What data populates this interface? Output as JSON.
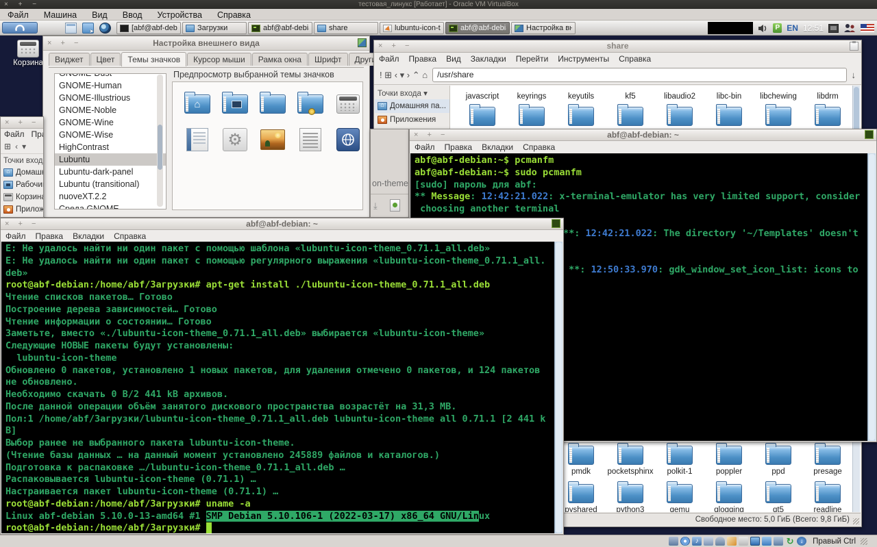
{
  "host": {
    "controls": "× + −",
    "title": "тестовая_линукс [Работает] - Oracle VM VirtualBox",
    "menu": [
      "Файл",
      "Машина",
      "Вид",
      "Ввод",
      "Устройства",
      "Справка"
    ],
    "status_hint": "Правый Ctrl",
    "status_icons": [
      "hdd-icon",
      "optical-icon",
      "audio-icon",
      "network-icon",
      "usb-icon",
      "pen-icon",
      "card-icon",
      "display-icon",
      "sharedfolder-icon",
      "video-icon",
      "refresh-icon",
      "download-icon"
    ]
  },
  "panel": {
    "launchers": [
      "show-desktop-icon",
      "file-manager-icon",
      "web-browser-icon"
    ],
    "taskbar": [
      {
        "label": "[abf@abf-debian...",
        "icon": "monitor",
        "active": false
      },
      {
        "label": "Загрузки",
        "icon": "folder",
        "active": false
      },
      {
        "label": "abf@abf-debian:...",
        "icon": "terminal",
        "active": false
      },
      {
        "label": "share",
        "icon": "folder",
        "active": false
      },
      {
        "label": "lubuntu-icon-the...",
        "icon": "archive",
        "active": false
      },
      {
        "label": "abf@abf-debian:...",
        "icon": "terminal",
        "active": true
      },
      {
        "label": "Настройка вне...",
        "icon": "settings",
        "active": false
      }
    ],
    "tray": {
      "lang": "EN",
      "clock": "12:51"
    }
  },
  "desktop": {
    "trash_label": "Корзина"
  },
  "appearance": {
    "controls": "× + −",
    "title": "Настройка внешнего вида",
    "tabs": [
      "Виджет",
      "Цвет",
      "Темы значков",
      "Курсор мыши",
      "Рамка окна",
      "Шрифт",
      "Другие"
    ],
    "active_tab_index": 2,
    "themes": [
      "GNOME-Dust",
      "GNOME-Human",
      "GNOME-Illustrious",
      "GNOME-Noble",
      "GNOME-Wine",
      "GNOME-Wise",
      "HighContrast",
      "Lubuntu",
      "Lubuntu-dark-panel",
      "Lubuntu (transitional)",
      "nuoveXT.2.2",
      "Среда GNOME"
    ],
    "selected_theme": "Lubuntu",
    "preview_label": "Предпросмотр выбранной темы значков",
    "preview_icons_row1": [
      "folder-home-icon",
      "folder-desktop-icon",
      "folder-icon",
      "folder-network-icon",
      "calculator-icon"
    ],
    "preview_icons_row2": [
      "book-icon",
      "gear-icon",
      "image-icon",
      "document-icon",
      "globe-icon"
    ]
  },
  "left_fm": {
    "controls": "× + −",
    "menu": [
      "Файл",
      "Правка"
    ],
    "toolbar": [
      "⊞",
      "‹",
      "▾"
    ],
    "places_label": "Точки входа",
    "places": [
      {
        "label": "Домашняя",
        "icon": "home"
      },
      {
        "label": "Рабочий",
        "icon": "desktop"
      },
      {
        "label": "Корзина",
        "icon": "trash"
      },
      {
        "label": "Приложения",
        "icon": "apps"
      }
    ]
  },
  "archive": {
    "label": "on-theme"
  },
  "share": {
    "controls": "× + −",
    "title": "share",
    "menu": [
      "Файл",
      "Правка",
      "Вид",
      "Закладки",
      "Перейти",
      "Инструменты",
      "Справка"
    ],
    "toolbar_glyphs": [
      "!",
      "⊞",
      "‹",
      "▾",
      "›",
      "⌃",
      "⌂"
    ],
    "path": "/usr/share",
    "path_end_glyph": "↓",
    "places_label": "Точки входа  ▾",
    "places": [
      {
        "label": "Домашняя па...",
        "icon": "home"
      },
      {
        "label": "Приложения",
        "icon": "apps"
      }
    ],
    "row_top": [
      "javascript",
      "keyrings",
      "keyutils",
      "kf5",
      "libaudio2",
      "libc-bin",
      "libchewing",
      "libdrm"
    ],
    "row_mid_count": 8,
    "row_p": [
      "pmdk",
      "pocketsphinx",
      "polkit-1",
      "poppler",
      "ppd",
      "presage"
    ],
    "row_q": [
      "pyshared",
      "python3",
      "qemu",
      "qlogging",
      "qt5",
      "readline"
    ],
    "status": "Свободное место: 5,0 ГиБ (Всего: 9,8 ГиБ)"
  },
  "terminal_right": {
    "controls": "× + −",
    "title": "abf@abf-debian: ~",
    "menu": [
      "Файл",
      "Правка",
      "Вкладки",
      "Справка"
    ],
    "lines": [
      [
        {
          "c": "p",
          "t": "abf@abf-debian:~$"
        },
        {
          "c": "p",
          "t": " pcmanfm"
        }
      ],
      [
        {
          "c": "p",
          "t": "abf@abf-debian:~$"
        },
        {
          "c": "p",
          "t": " sudo pcmanfm"
        }
      ],
      [
        {
          "c": "o",
          "t": "[sudo] пароль для abf:"
        }
      ],
      [
        {
          "c": "o",
          "t": "** "
        },
        {
          "c": "p",
          "t": "Message"
        },
        {
          "c": "o",
          "t": ": "
        },
        {
          "c": "b",
          "t": "12:42:21.022"
        },
        {
          "c": "o",
          "t": ": x-terminal-emulator has very limited support, consider"
        }
      ],
      [
        {
          "c": "o",
          "t": " choosing another terminal"
        }
      ],
      [],
      [
        {
          "m": 217,
          "c": "o",
          "t": "**: "
        },
        {
          "c": "b",
          "t": "12:42:21.022"
        },
        {
          "c": "o",
          "t": ": The directory '~/Templates' doesn't"
        }
      ],
      [],
      [],
      [
        {
          "m": 225,
          "c": "o",
          "t": "**: "
        },
        {
          "c": "b",
          "t": "12:50:33.970"
        },
        {
          "c": "o",
          "t": ": gdk_window_set_icon_list: icons to"
        }
      ]
    ]
  },
  "terminal_main": {
    "controls": "× + −",
    "title": "abf@abf-debian: ~",
    "menu": [
      "Файл",
      "Правка",
      "Вкладки",
      "Справка"
    ],
    "lines": [
      [
        {
          "c": "o",
          "t": "E: Не удалось найти ни один пакет с помощью шаблона «lubuntu-icon-theme_0.71.1_all.deb»"
        }
      ],
      [
        {
          "c": "o",
          "t": "E: Не удалось найти ни один пакет с помощью регулярного выражения «lubuntu-icon-theme_0.71.1_all."
        }
      ],
      [
        {
          "c": "o",
          "t": "deb»"
        }
      ],
      [
        {
          "c": "p",
          "t": "root@abf-debian:/home/abf/Загрузки#"
        },
        {
          "c": "p",
          "t": " apt-get install ./lubuntu-icon-theme_0.71.1_all.deb"
        }
      ],
      [
        {
          "c": "o",
          "t": "Чтение списков пакетов… Готово"
        }
      ],
      [
        {
          "c": "o",
          "t": "Построение дерева зависимостей… Готово"
        }
      ],
      [
        {
          "c": "o",
          "t": "Чтение информации о состоянии… Готово"
        }
      ],
      [
        {
          "c": "o",
          "t": "Заметьте, вместо «./lubuntu-icon-theme_0.71.1_all.deb» выбирается «lubuntu-icon-theme»"
        }
      ],
      [
        {
          "c": "o",
          "t": "Следующие НОВЫЕ пакеты будут установлены:"
        }
      ],
      [
        {
          "c": "o",
          "t": "  lubuntu-icon-theme"
        }
      ],
      [
        {
          "c": "o",
          "t": "Обновлено 0 пакетов, установлено 1 новых пакетов, для удаления отмечено 0 пакетов, и 124 пакетов"
        }
      ],
      [
        {
          "c": "o",
          "t": "не обновлено."
        }
      ],
      [
        {
          "c": "o",
          "t": "Необходимо скачать 0 B/2 441 kB архивов."
        }
      ],
      [
        {
          "c": "o",
          "t": "После данной операции объём занятого дискового пространства возрастёт на 31,3 MB."
        }
      ],
      [
        {
          "c": "o",
          "t": "Пол:1 /home/abf/Загрузки/lubuntu-icon-theme_0.71.1_all.deb lubuntu-icon-theme all 0.71.1 [2 441 k"
        }
      ],
      [
        {
          "c": "o",
          "t": "B]"
        }
      ],
      [
        {
          "c": "o",
          "t": "Выбор ранее не выбранного пакета lubuntu-icon-theme."
        }
      ],
      [
        {
          "c": "o",
          "t": "(Чтение базы данных … на данный момент установлено 245889 файлов и каталогов.)"
        }
      ],
      [
        {
          "c": "o",
          "t": "Подготовка к распаковке …/lubuntu-icon-theme_0.71.1_all.deb …"
        }
      ],
      [
        {
          "c": "o",
          "t": "Распаковывается lubuntu-icon-theme (0.71.1) …"
        }
      ],
      [
        {
          "c": "o",
          "t": "Настраивается пакет lubuntu-icon-theme (0.71.1) …"
        }
      ],
      [
        {
          "c": "p",
          "t": "root@abf-debian:/home/abf/Загрузки#"
        },
        {
          "c": "p",
          "t": " uname -a"
        }
      ],
      [
        {
          "c": "o",
          "t": "Linux abf-debian 5.10.0-13-amd64 #1 "
        },
        {
          "c": "h",
          "t": "SMP Debian 5.10.106-1 (2022-03-17) x86_64 GNU/Lin"
        },
        {
          "c": "o",
          "t": "ux"
        }
      ],
      [
        {
          "c": "p",
          "t": "root@abf-debian:/home/abf/Загрузки# "
        },
        {
          "c": "cur",
          "t": "_"
        }
      ]
    ]
  }
}
